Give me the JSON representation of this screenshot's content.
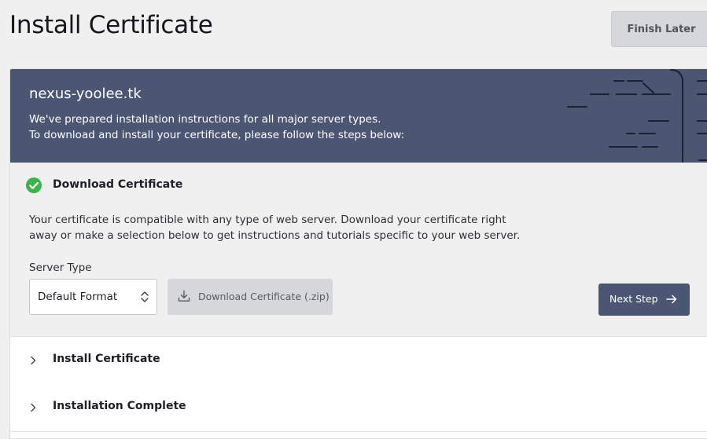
{
  "header": {
    "title": "Install Certificate",
    "finish_later_label": "Finish Later"
  },
  "banner": {
    "domain": "nexus-yoolee.tk",
    "line1": "We've prepared installation instructions for all major server types.",
    "line2": "To download and install your certificate, please follow the steps below:",
    "color": "#4b5673"
  },
  "steps": [
    {
      "title": "Download Certificate",
      "status": "complete",
      "status_icon": "check-circle-icon",
      "status_color": "#3ab54a",
      "description_line1": "Your certificate is compatible with any type of web server. Download your certificate right",
      "description_line2": "away or make a selection below to get instructions and tutorials specific to your web server.",
      "server_type_label": "Server Type",
      "server_type_value": "Default Format",
      "download_label": "Download Certificate (.zip)",
      "next_label": "Next Step"
    },
    {
      "title": "Install Certificate",
      "icon": "chevron-right-icon"
    },
    {
      "title": "Installation Complete",
      "icon": "chevron-right-icon"
    }
  ]
}
